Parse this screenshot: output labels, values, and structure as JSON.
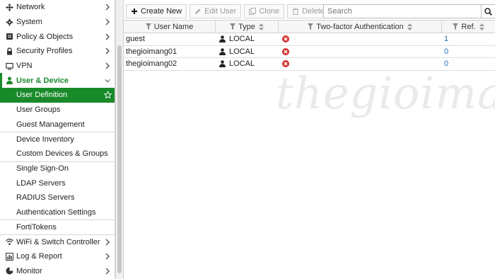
{
  "sidebar": {
    "items": [
      {
        "label": "Network",
        "icon": "network-icon",
        "chevron": true
      },
      {
        "label": "System",
        "icon": "gear-icon",
        "chevron": true
      },
      {
        "label": "Policy & Objects",
        "icon": "policy-icon",
        "chevron": true
      },
      {
        "label": "Security Profiles",
        "icon": "lock-icon",
        "chevron": true
      },
      {
        "label": "VPN",
        "icon": "monitor-icon",
        "chevron": true
      },
      {
        "label": "User & Device",
        "icon": "user-icon",
        "chevron": true,
        "open": true
      }
    ],
    "user_device_subitems": [
      {
        "label": "User Definition",
        "active": true
      },
      {
        "label": "User Groups"
      },
      {
        "label": "Guest Management"
      },
      {
        "label": "Device Inventory"
      },
      {
        "label": "Custom Devices & Groups"
      },
      {
        "label": "Single Sign-On"
      },
      {
        "label": "LDAP Servers"
      },
      {
        "label": "RADIUS Servers"
      },
      {
        "label": "Authentication Settings"
      },
      {
        "label": "FortiTokens"
      }
    ],
    "bottom_items": [
      {
        "label": "WiFi & Switch Controller",
        "icon": "wifi-icon"
      },
      {
        "label": "Log & Report",
        "icon": "chart-icon"
      },
      {
        "label": "Monitor",
        "icon": "pie-icon"
      }
    ]
  },
  "toolbar": {
    "create_new": "Create New",
    "edit_user": "Edit User",
    "clone": "Clone",
    "delete": "Delete",
    "search_placeholder": "Search"
  },
  "table": {
    "columns": [
      "User Name",
      "Type",
      "Two-factor Authentication",
      "Ref."
    ],
    "rows": [
      {
        "user_name": "guest",
        "type": "LOCAL",
        "two_factor": "disabled",
        "ref": "1"
      },
      {
        "user_name": "thegioimang01",
        "type": "LOCAL",
        "two_factor": "disabled",
        "ref": "0"
      },
      {
        "user_name": "thegioimang02",
        "type": "LOCAL",
        "two_factor": "disabled",
        "ref": "0"
      }
    ]
  },
  "watermark": "thegioimang.vn",
  "colors": {
    "accent": "#198a2a",
    "link": "#1f6fb5",
    "error": "#d32f2f"
  }
}
